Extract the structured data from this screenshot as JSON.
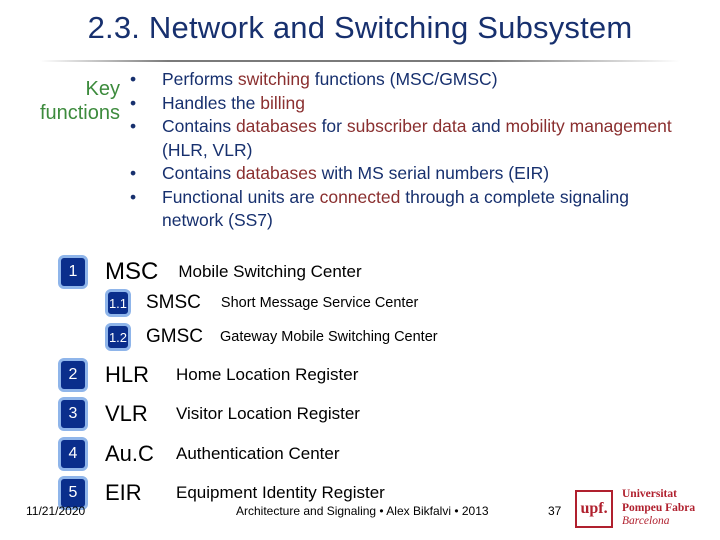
{
  "title": "2.3. Network and Switching Subsystem",
  "key_label": {
    "line1": "Key",
    "line2": "functions"
  },
  "colors": {
    "title": "#17306e",
    "key_label": "#3d8b3d",
    "highlight": "#8a2f2f",
    "badge_fill": "#0a2e8c",
    "badge_border": "#8fb5ea",
    "logo": "#b0202e"
  },
  "bullets": [
    {
      "segments": [
        {
          "text": "Performs ",
          "hl": false
        },
        {
          "text": "switching",
          "hl": true
        },
        {
          "text": " functions (MSC/GMSC)",
          "hl": false
        }
      ]
    },
    {
      "segments": [
        {
          "text": "Handles the ",
          "hl": false
        },
        {
          "text": "billing",
          "hl": true
        }
      ]
    },
    {
      "segments": [
        {
          "text": "Contains ",
          "hl": false
        },
        {
          "text": "databases",
          "hl": true
        },
        {
          "text": " for ",
          "hl": false
        },
        {
          "text": "subscriber data",
          "hl": true
        },
        {
          "text": " and ",
          "hl": false
        },
        {
          "text": "mobility management",
          "hl": true
        },
        {
          "text": " (HLR, VLR)",
          "hl": false
        }
      ]
    },
    {
      "segments": [
        {
          "text": "Contains ",
          "hl": false
        },
        {
          "text": "databases",
          "hl": true
        },
        {
          "text": " with MS serial numbers (EIR)",
          "hl": false
        }
      ]
    },
    {
      "segments": [
        {
          "text": "Functional units are ",
          "hl": false
        },
        {
          "text": "connected",
          "hl": true
        },
        {
          "text": " through a complete signaling network (SS7)",
          "hl": false
        }
      ]
    }
  ],
  "bullet_symbol": "•",
  "items": [
    {
      "num": "1",
      "abbr": "MSC",
      "full": "Mobile Switching Center"
    },
    {
      "num": "1.1",
      "abbr": "SMSC",
      "full": "Short Message Service Center"
    },
    {
      "num": "1.2",
      "abbr": "GMSC",
      "full": "Gateway Mobile Switching Center"
    },
    {
      "num": "2",
      "abbr": "HLR",
      "full": "Home Location Register"
    },
    {
      "num": "3",
      "abbr": "VLR",
      "full": "Visitor Location Register"
    },
    {
      "num": "4",
      "abbr": "Au.C",
      "full": "Authentication Center"
    },
    {
      "num": "5",
      "abbr": "EIR",
      "full": "Equipment Identity Register"
    }
  ],
  "footer": {
    "date": "11/21/2020",
    "center": "Architecture and Signaling • Alex Bikfalvi • 2013",
    "page": "37"
  },
  "logo": {
    "mark": "upf.",
    "line1": "Universitat",
    "line2": "Pompeu Fabra",
    "line3": "Barcelona"
  }
}
